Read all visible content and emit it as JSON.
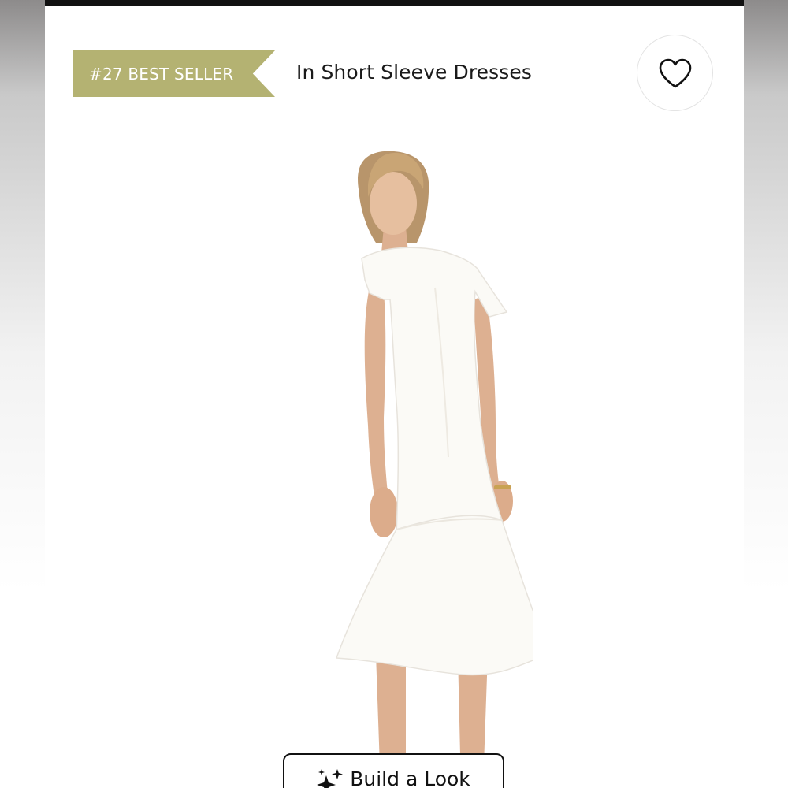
{
  "badge": {
    "text": "#27 BEST SELLER",
    "color": "#b4b272"
  },
  "category": {
    "text": "In Short Sleeve Dresses"
  },
  "wishlist": {
    "icon": "heart-outline-icon"
  },
  "product": {
    "image_subject": "model wearing white short sleeve midi dress with flounce hem",
    "dress_color": "#fbfaf6"
  },
  "build_look": {
    "label": "Build a Look",
    "icon": "sparkle-icon"
  }
}
